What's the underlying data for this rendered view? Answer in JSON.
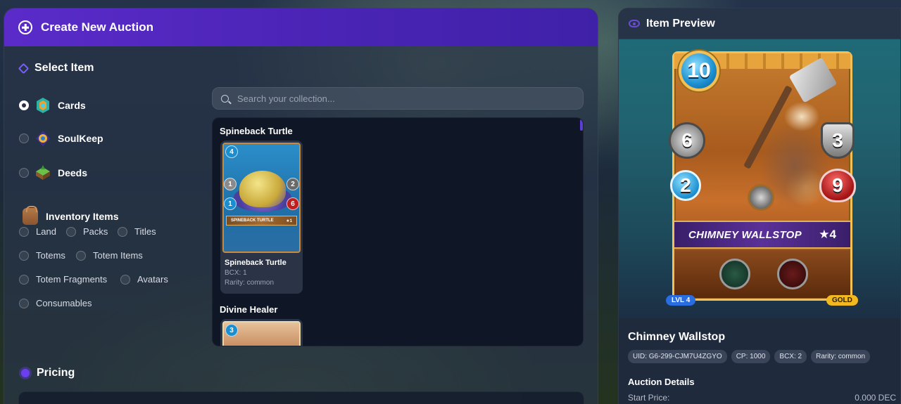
{
  "left_panel": {
    "title": "Create New Auction",
    "select_item_title": "Select Item",
    "item_types": [
      {
        "label": "Cards",
        "selected": true,
        "icon": "cards-icon"
      },
      {
        "label": "SoulKeep",
        "selected": false,
        "icon": "soulkeep-icon"
      },
      {
        "label": "Deeds",
        "selected": false,
        "icon": "deeds-icon"
      }
    ],
    "inventory_title": "Inventory Items",
    "inventory_items": [
      {
        "label": "Land"
      },
      {
        "label": "Packs"
      },
      {
        "label": "Titles"
      },
      {
        "label": "Totems"
      },
      {
        "label": "Totem Items"
      },
      {
        "label": "Totem Fragments"
      },
      {
        "label": "Avatars"
      },
      {
        "label": "Consumables"
      }
    ],
    "search": {
      "placeholder": "Search your collection..."
    },
    "collection": [
      {
        "group": "Spineback Turtle",
        "card_name": "Spineback Turtle",
        "bcx": "BCX: 1",
        "rarity": "Rarity: common",
        "art_label": "SPINEBACK TURTLE",
        "art_level": "★1",
        "stats": {
          "mana": "4",
          "attack": "1",
          "armor": "2",
          "speed": "1",
          "health": "6"
        }
      },
      {
        "group": "Divine Healer",
        "stats": {
          "mana": "3"
        }
      }
    ],
    "pricing_title": "Pricing"
  },
  "right_panel": {
    "title": "Item Preview",
    "card": {
      "mana": "10",
      "attack": "6",
      "armor": "3",
      "speed": "2",
      "health": "9",
      "name": "CHIMNEY WALLSTOP",
      "level_star": "★4",
      "lvl_badge": "LVL 4",
      "edition_badge": "GOLD"
    },
    "item_name": "Chimney Wallstop",
    "chips": [
      "UID: G6-299-CJM7U4ZGYO",
      "CP: 1000",
      "BCX: 2",
      "Rarity: common"
    ],
    "auction_details_title": "Auction Details",
    "start_price_label": "Start Price:",
    "start_price_value": "0.000 DEC"
  },
  "colors": {
    "header_purple": "#5a2bc9",
    "accent_purple": "#6b3ff0",
    "gold": "#f1b81f",
    "level_blue": "#2a6de0"
  }
}
